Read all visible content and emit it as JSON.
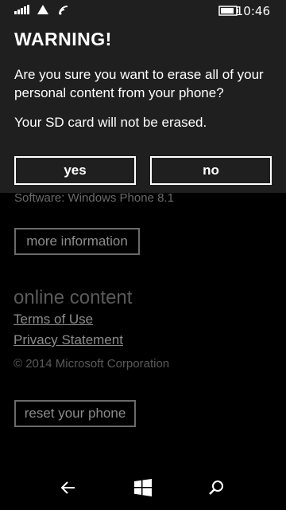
{
  "status_bar": {
    "time": "10:46",
    "icons": [
      "signal-icon",
      "data-icon",
      "wifi-icon",
      "battery-icon"
    ]
  },
  "dialog": {
    "title": "WARNING!",
    "message": "Are you sure you want to erase all of your personal content from your phone?",
    "note": "Your SD card will not be erased.",
    "yes_label": "yes",
    "no_label": "no"
  },
  "page": {
    "software_text": "Software: Windows Phone 8.1",
    "more_info_label": "more information",
    "online_content_title": "online content",
    "terms_link": "Terms of Use",
    "privacy_link": "Privacy Statement",
    "copyright": "© 2014 Microsoft Corporation",
    "reset_label": "reset your phone"
  },
  "nav_bar": {
    "icons": [
      "back-icon",
      "windows-start-icon",
      "search-icon"
    ]
  },
  "colors": {
    "background": "#000000",
    "dialog_background": "#1f1f1f",
    "dimmed_text": "#6a6a6a"
  }
}
